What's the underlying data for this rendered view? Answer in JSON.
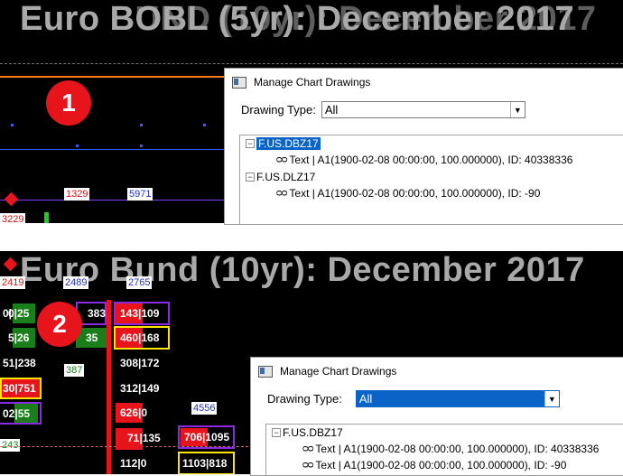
{
  "panel1": {
    "title": "Euro BOBL (5yr): December 2017",
    "title_overlay": "Euro BUND (10yr): December 2017",
    "badge": "1",
    "labels": {
      "red_a": "1329",
      "blue_a": "5971",
      "red_left": "3229"
    }
  },
  "panel2": {
    "title": "Euro Bund (10yr): December 2017",
    "badge": "2",
    "labels": {
      "red_top": "2419",
      "blue_1": "2489",
      "blue_2": "2765",
      "green_387": "387",
      "blue_4556": "4556",
      "green_243": "243"
    },
    "cells": [
      {
        "l": "0|25",
        "r": "383"
      },
      {
        "l": "5|26",
        "r": "35"
      },
      {
        "l": "51|238",
        "r": ""
      },
      {
        "l": "30|751",
        "r": ""
      },
      {
        "l": "02|55",
        "r": ""
      },
      {
        "l": "143|109",
        "r": ""
      },
      {
        "l": "460|168",
        "r": ""
      },
      {
        "l": "308|172",
        "r": ""
      },
      {
        "l": "312|149",
        "r": ""
      },
      {
        "l": "626|0",
        "r": ""
      },
      {
        "l": "71|135",
        "r": ""
      },
      {
        "l": "112|0",
        "r": ""
      },
      {
        "l": "706|1095",
        "r": ""
      },
      {
        "l": "1103|818",
        "r": ""
      }
    ]
  },
  "dialog1": {
    "title": "Manage Chart Drawings",
    "drawing_type_label": "Drawing Type:",
    "drawing_type_value": "All",
    "tree": [
      {
        "symbol": "F.US.DBZ17",
        "child": "Text | A1(1900-02-08  00:00:00, 100.000000), ID: 40338336"
      },
      {
        "symbol": "F.US.DLZ17",
        "child": "Text | A1(1900-02-08  00:00:00, 100.000000), ID: -90"
      }
    ]
  },
  "dialog2": {
    "title": "Manage Chart Drawings",
    "drawing_type_label": "Drawing Type:",
    "drawing_type_value": "All",
    "tree": [
      {
        "symbol": "F.US.DBZ17",
        "child": "Text | A1(1900-02-08  00:00:00, 100.000000), ID: 40338336"
      },
      {
        "symbol": "",
        "child": "Text | A1(1900-02-08  00:00:00, 100.000000), ID: -90"
      }
    ]
  },
  "icons": {
    "expand": "minus-box-icon",
    "glasses": "glasses-icon",
    "window": "window-icon",
    "dropdown": "chevron-down-icon"
  },
  "colors": {
    "accent_red": "#e8141c",
    "select_blue": "#0a64c8",
    "title_gray": "#a9a9a9"
  }
}
